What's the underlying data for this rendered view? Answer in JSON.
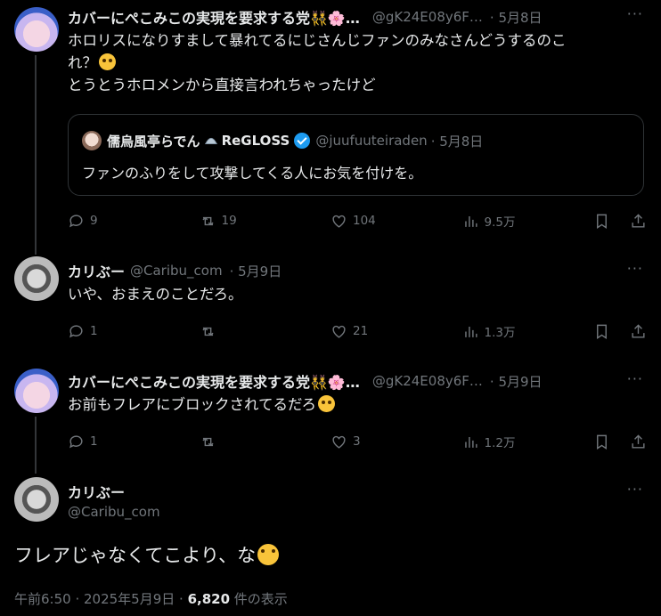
{
  "tweets": [
    {
      "author": "カバーにぺこみこの実現を要求する党👯🌸…",
      "handle": "@gK24E08y6F…",
      "date": "· 5月8日",
      "text_line1": "ホロリスになりすまして暴れてるにじさんじファンのみなさんどうするのこ",
      "text_line2": "れ？",
      "text_line3": "とうとうホロメンから直接言われちゃったけど",
      "quote": {
        "author": "儒烏風亭らでん",
        "org": "ReGLOSS",
        "handle": "@juufuuteiraden",
        "date": "· 5月8日",
        "text": "ファンのふりをして攻撃してくる人にお気を付けを。"
      },
      "replies": "9",
      "reposts": "19",
      "likes": "104",
      "views": "9.5万"
    },
    {
      "author": "カリぶー",
      "handle": "@Caribu_com",
      "date": "· 5月9日",
      "text": "いや、おまえのことだろ。",
      "replies": "1",
      "reposts": "",
      "likes": "21",
      "views": "1.3万"
    },
    {
      "author": "カバーにぺこみこの実現を要求する党👯🌸…",
      "handle": "@gK24E08y6F…",
      "date": "· 5月9日",
      "text": "お前もフレアにブロックされてるだろ",
      "replies": "1",
      "reposts": "",
      "likes": "3",
      "views": "1.2万"
    }
  ],
  "main": {
    "author": "カリぶー",
    "handle": "@Caribu_com",
    "text": "フレアじゃなくてこより、な",
    "time": "午前6:50 · 2025年5月9日 · ",
    "views_count": "6,820",
    "views_label": " 件の表示"
  },
  "colors": {
    "bg": "#000000",
    "text": "#e7e9ea",
    "muted": "#71767b",
    "border": "#2f3336",
    "verified": "#1d9bf0"
  }
}
